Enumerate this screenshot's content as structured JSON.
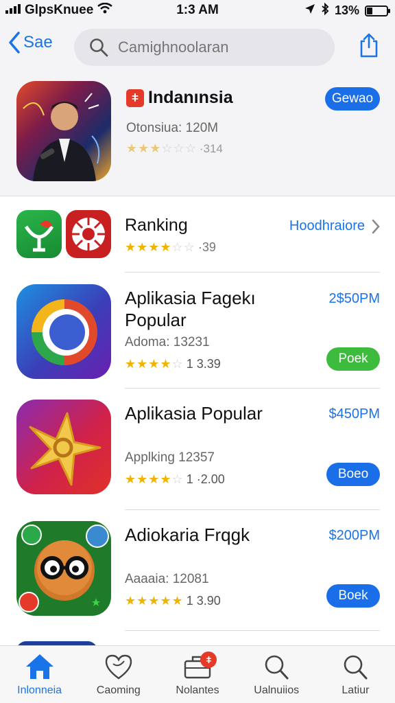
{
  "status_bar": {
    "carrier": "GlpsKnuee",
    "time": "1:3 AM",
    "battery": "13%",
    "battery_level": 0.3
  },
  "nav": {
    "back_label": "Sae",
    "search_placeholder": "Camighnoolaran"
  },
  "featured": {
    "badge_glyph": "ǂ",
    "title": "Indanınsia",
    "meta": "Otonsiua: 120M",
    "rating_text": "·314",
    "button_label": "Gewao"
  },
  "ranking": {
    "title": "Ranking",
    "rating_text": "·39",
    "link_label": "Hoodhraiore"
  },
  "apps": [
    {
      "title": "Aplikasia Fagekı Popular",
      "meta": "Adoma: 13231",
      "rating_text": "1  3.39",
      "price": "2$50PM",
      "button_label": "Poek",
      "button_color": "#3dbb3d"
    },
    {
      "title": "Aplikasia Popular",
      "meta": "Applking 12357",
      "rating_text": "1 ·2.00",
      "price": "$450PM",
      "button_label": "Boeo",
      "button_color": "#1a6ee8"
    },
    {
      "title": "Adiokaria Frqgk",
      "meta": "Aaaaia: 12081",
      "rating_text": "1  3.90",
      "price": "$200PM",
      "button_label": "Boek",
      "button_color": "#1a6ee8"
    }
  ],
  "tabs": [
    {
      "label": "Inlonneia",
      "icon": "home-icon",
      "active": true
    },
    {
      "label": "Caoming",
      "icon": "heart-icon",
      "active": false
    },
    {
      "label": "Nolantes",
      "icon": "briefcase-icon",
      "active": false,
      "badge": "ǂ"
    },
    {
      "label": "Ualnuiios",
      "icon": "search-icon",
      "active": false
    },
    {
      "label": "Latiur",
      "icon": "search-icon",
      "active": false
    }
  ],
  "colors": {
    "accent": "#1a73e8",
    "green": "#3dbb3d",
    "badge_red": "#e53a2a",
    "star": "#f0b400"
  }
}
